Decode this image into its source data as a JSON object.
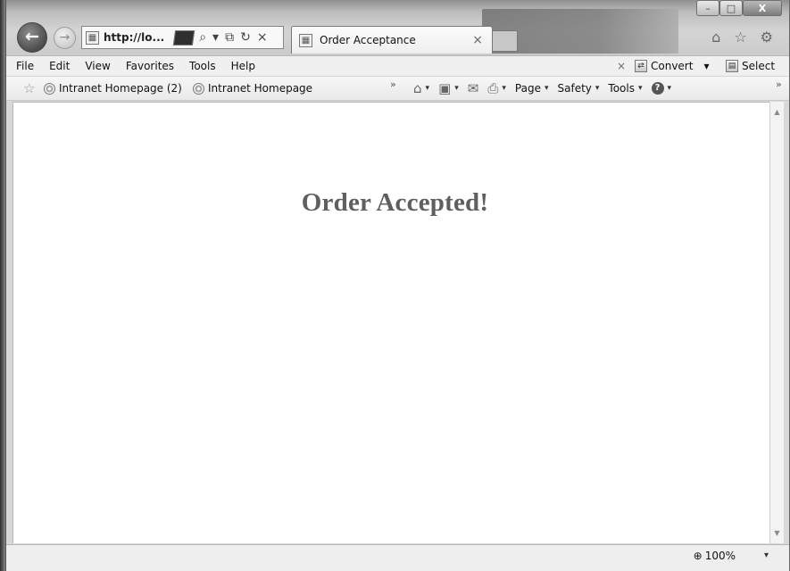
{
  "window": {
    "title_controls": {
      "minimize": "–",
      "maximize": "□",
      "close": "X"
    }
  },
  "navigation": {
    "back_icon": "←",
    "forward_icon": "→",
    "address_text": "http://lo...",
    "address_actions": [
      "⌕",
      "▾",
      "⧉",
      "↻",
      "×"
    ]
  },
  "tab": {
    "title": "Order Acceptance",
    "close": "×"
  },
  "browser_right_icons": [
    "⌂",
    "☆",
    "⚙"
  ],
  "menu": {
    "items": [
      "File",
      "Edit",
      "View",
      "Favorites",
      "Tools",
      "Help"
    ],
    "close_mark": "×",
    "convert_label": "Convert",
    "convert_drop": "▾",
    "select_label": "Select"
  },
  "favorites": {
    "links": [
      "Intranet Homepage (2)",
      "Intranet Homepage"
    ],
    "chevron_left": "»",
    "chevron_right": "»"
  },
  "commands": {
    "home_icon": "⌂",
    "feeds_icon": "▣",
    "mail_icon": "✉",
    "print_icon": "⎙",
    "page": "Page",
    "safety": "Safety",
    "tools": "Tools",
    "help_icon": "?",
    "drop": "▾"
  },
  "content": {
    "heading": "Order Accepted!"
  },
  "scrollbar": {
    "up": "▲",
    "down": "▼"
  },
  "status": {
    "zoom": "100%",
    "zoom_drop": "▾"
  }
}
